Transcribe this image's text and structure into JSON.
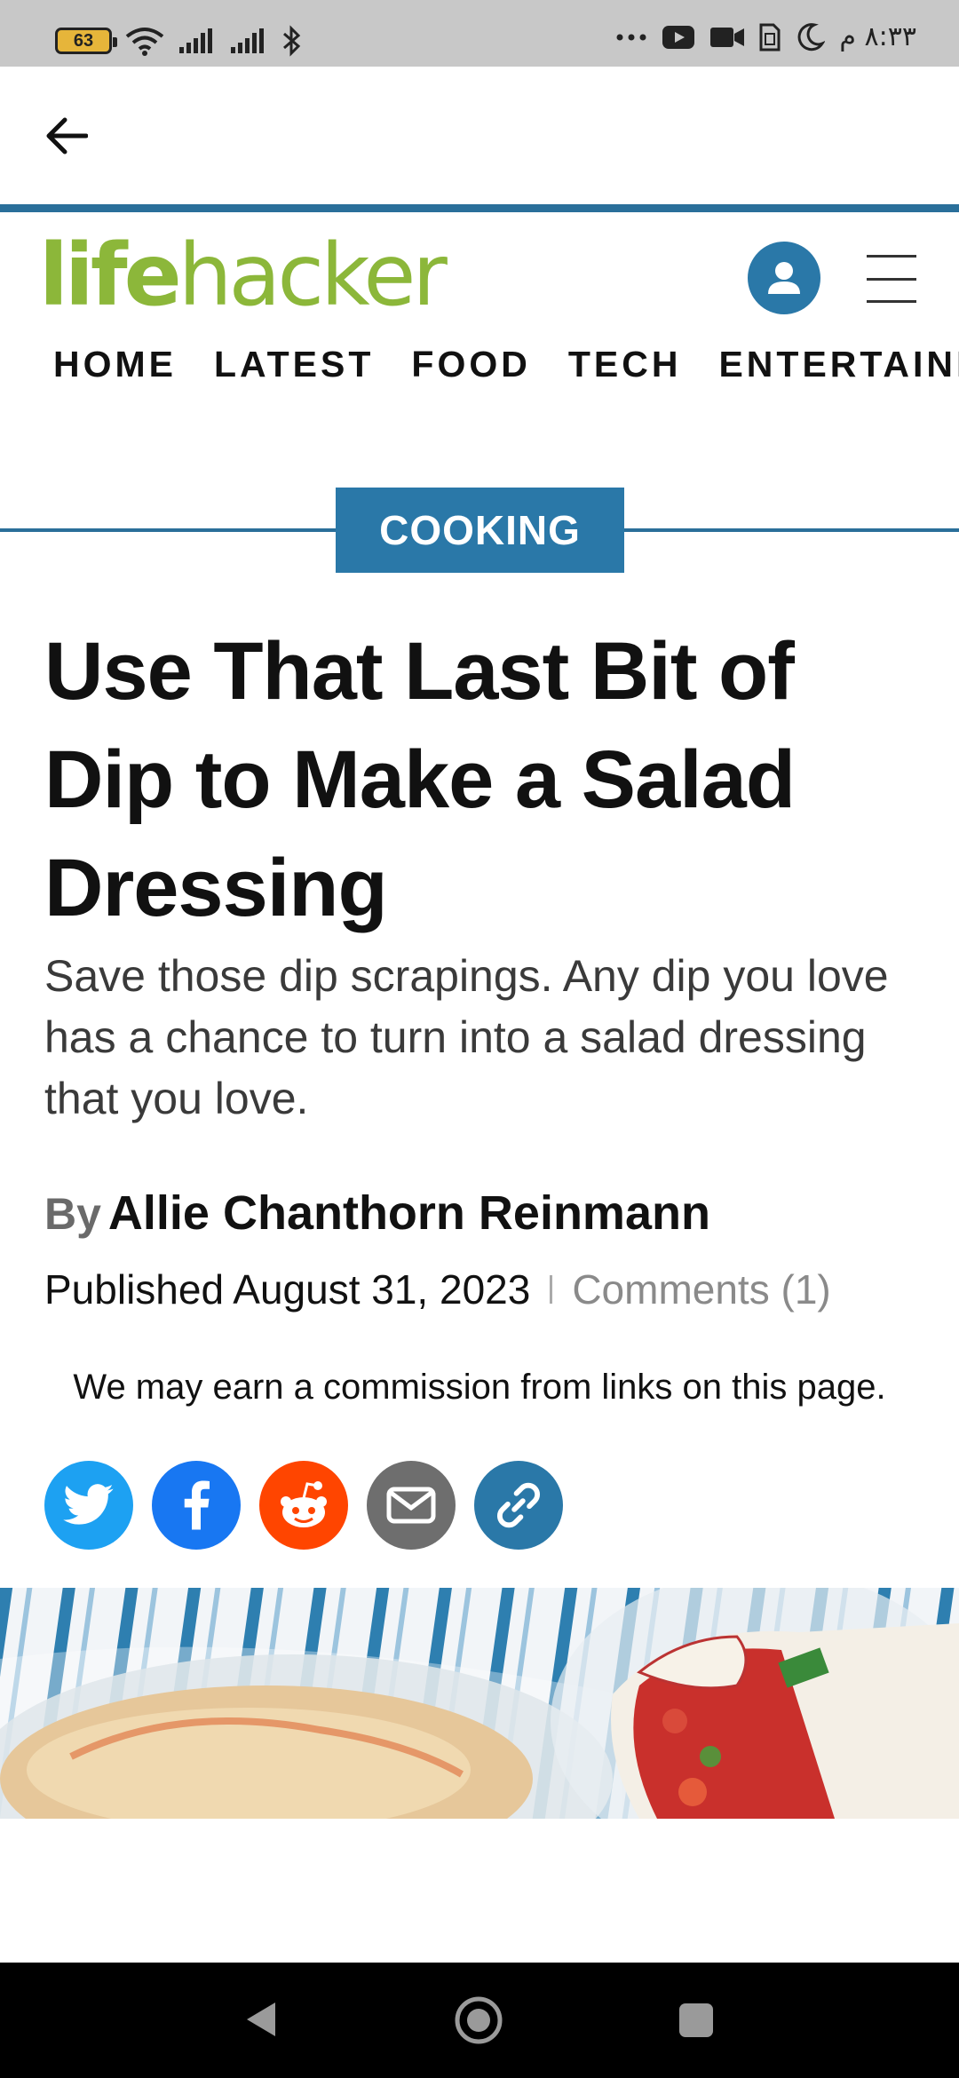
{
  "status_bar": {
    "battery": "63",
    "time": "٨:٣٣ م",
    "icons": [
      "battery-icon",
      "wifi-icon",
      "signal-icon",
      "signal-icon",
      "bluetooth-icon",
      "more-icon",
      "youtube-icon",
      "video-icon",
      "sim-icon",
      "moon-icon"
    ]
  },
  "site": {
    "logo_life": "life",
    "logo_hacker": "hacker",
    "brand_color": "#8cb73a",
    "accent_color": "#2a78a8"
  },
  "nav": {
    "items": [
      "HOME",
      "LATEST",
      "FOOD",
      "TECH",
      "ENTERTAINMEN"
    ]
  },
  "article": {
    "category": "COOKING",
    "headline": "Use That Last Bit of Dip to Make a Salad Dressing",
    "dek": "Save those dip scrapings. Any dip you love has a chance to turn into a salad dressing that you love.",
    "by_label": "By",
    "author": "Allie Chanthorn Reinmann",
    "published": "Published August 31, 2023",
    "comments": "Comments (1)",
    "disclaimer": "We may earn a commission from links on this page."
  },
  "share": {
    "buttons": [
      {
        "name": "twitter",
        "color": "#1da1f2"
      },
      {
        "name": "facebook",
        "color": "#1877f2"
      },
      {
        "name": "reddit",
        "color": "#ff4500"
      },
      {
        "name": "email",
        "color": "#6e6e6e"
      },
      {
        "name": "link",
        "color": "#2a78a8"
      }
    ]
  }
}
